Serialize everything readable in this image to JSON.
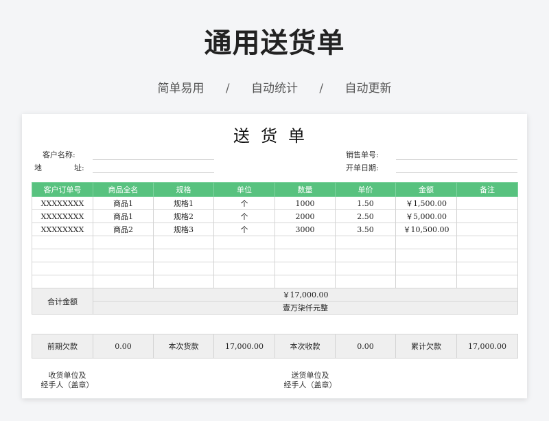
{
  "header": {
    "title": "通用送货单",
    "tags": [
      "简单易用",
      "自动统计",
      "自动更新"
    ],
    "separator": "/"
  },
  "form": {
    "title": "送货单",
    "customer_name_label": "客户名称:",
    "address_label_1": "地",
    "address_label_2": "址:",
    "order_no_label": "销售单号:",
    "date_label": "开单日期:"
  },
  "table": {
    "columns": [
      "客户订单号",
      "商品全名",
      "规格",
      "单位",
      "数量",
      "单价",
      "金额",
      "备注"
    ],
    "rows": [
      [
        "XXXXXXXX",
        "商品1",
        "规格1",
        "个",
        "1000",
        "1.50",
        "￥1,500.00",
        ""
      ],
      [
        "XXXXXXXX",
        "商品1",
        "规格2",
        "个",
        "2000",
        "2.50",
        "￥5,000.00",
        ""
      ],
      [
        "XXXXXXXX",
        "商品2",
        "规格3",
        "个",
        "3000",
        "3.50",
        "￥10,500.00",
        ""
      ],
      [
        "",
        "",
        "",
        "",
        "",
        "",
        "",
        ""
      ],
      [
        "",
        "",
        "",
        "",
        "",
        "",
        "",
        ""
      ],
      [
        "",
        "",
        "",
        "",
        "",
        "",
        "",
        ""
      ],
      [
        "",
        "",
        "",
        "",
        "",
        "",
        "",
        ""
      ]
    ],
    "total_label": "合计金额",
    "total_amount": "￥17,000.00",
    "total_amount_words": "壹万柒仟元整"
  },
  "summary": {
    "prev_debt_label": "前期欠款",
    "prev_debt_value": "0.00",
    "current_goods_label": "本次货款",
    "current_goods_value": "17,000.00",
    "current_received_label": "本次收款",
    "current_received_value": "0.00",
    "accum_debt_label": "累计欠款",
    "accum_debt_value": "17,000.00"
  },
  "signatures": {
    "receiver_line1": "收货单位及",
    "receiver_line2": "经手人（盖章）",
    "sender_line1": "送货单位及",
    "sender_line2": "经手人（盖章）"
  },
  "colors": {
    "header_green": "#58c27f",
    "page_bg": "#f4f5f7",
    "total_bg": "#efefef"
  }
}
